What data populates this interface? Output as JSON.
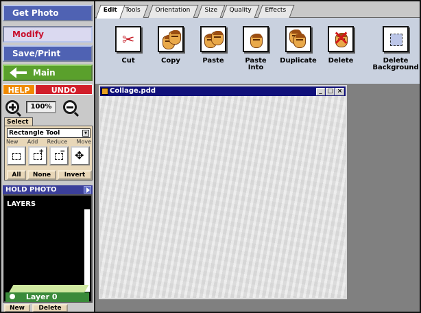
{
  "nav": {
    "get_photo": "Get Photo",
    "modify": "Modify",
    "save_print": "Save/Print",
    "main": "Main"
  },
  "help": "HELP",
  "undo": "UNDO",
  "zoom": "100%",
  "select": {
    "tab": "Select",
    "tool": "Rectangle Tool",
    "modes": [
      "New",
      "Add",
      "Reduce",
      "Move"
    ],
    "all": "All",
    "none": "None",
    "invert": "Invert"
  },
  "hold_photo": "HOLD PHOTO",
  "layers": {
    "title": "LAYERS",
    "layer_name": "Layer 0",
    "new": "New",
    "delete": "Delete"
  },
  "tabs": [
    "Edit",
    "Tools",
    "Orientation",
    "Size",
    "Quality",
    "Effects"
  ],
  "actions": [
    {
      "label": "Cut"
    },
    {
      "label": "Copy"
    },
    {
      "label": "Paste"
    },
    {
      "label": "Paste\nInto"
    },
    {
      "label": "Duplicate"
    },
    {
      "label": "Delete"
    },
    {
      "label": "Delete\nBackground"
    }
  ],
  "window": {
    "title": "Collage.pdd",
    "min": "_",
    "max": "□",
    "close": "×"
  },
  "colors": {
    "nav_blue": "#4f62b3",
    "modify_red": "#c8102e",
    "main_green": "#5aa02c",
    "help_orange": "#f08a00",
    "undo_red": "#d11f2a",
    "title_bar": "#10107a"
  }
}
